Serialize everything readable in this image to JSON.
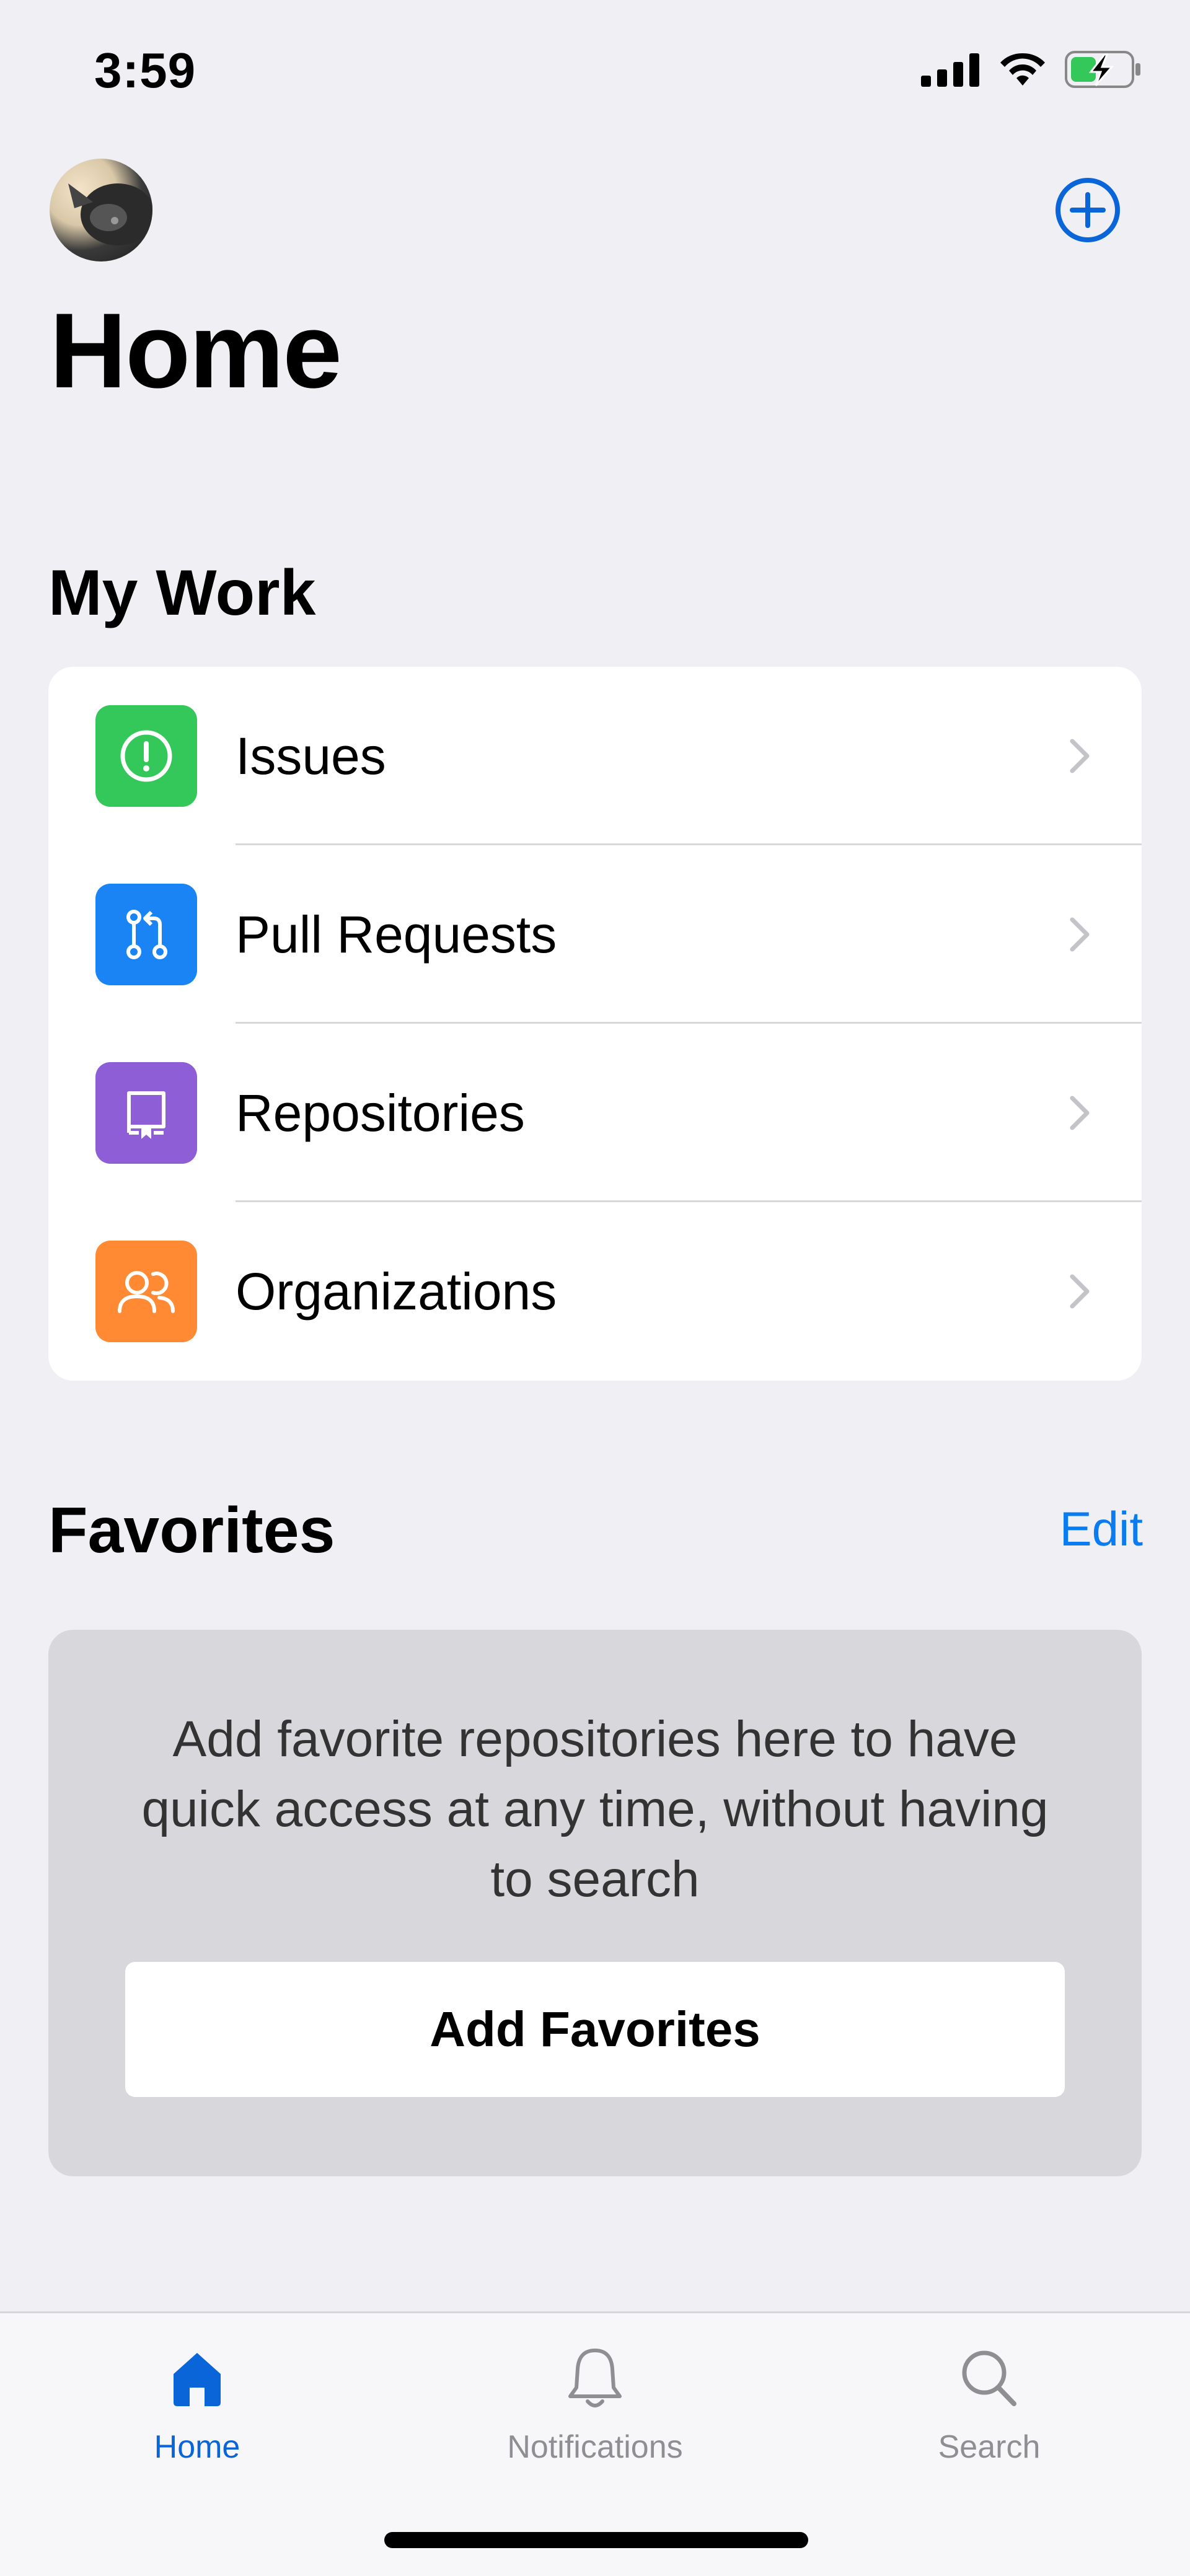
{
  "status_bar": {
    "time": "3:59",
    "icons": [
      "cellular-signal-icon",
      "wifi-icon",
      "battery-charging-icon"
    ]
  },
  "header": {
    "title": "Home",
    "avatar_icon": "user-avatar",
    "add_icon": "plus-circle-icon"
  },
  "my_work": {
    "title": "My Work",
    "items": [
      {
        "label": "Issues",
        "icon": "issue-opened-icon",
        "color": "#34c759"
      },
      {
        "label": "Pull Requests",
        "icon": "git-pull-request-icon",
        "color": "#1a84f5"
      },
      {
        "label": "Repositories",
        "icon": "repo-icon",
        "color": "#8e5ed6"
      },
      {
        "label": "Organizations",
        "icon": "organization-icon",
        "color": "#ff8a33"
      }
    ]
  },
  "favorites": {
    "title": "Favorites",
    "edit_label": "Edit",
    "empty_message": "Add favorite repositories here to have quick access at any time, without having to search",
    "add_button_label": "Add Favorites"
  },
  "tab_bar": {
    "tabs": [
      {
        "label": "Home",
        "icon": "home-icon",
        "active": true
      },
      {
        "label": "Notifications",
        "icon": "bell-icon",
        "active": false
      },
      {
        "label": "Search",
        "icon": "search-icon",
        "active": false
      }
    ]
  },
  "colors": {
    "accent": "#0a66d8",
    "link": "#0a7cf0",
    "background": "#efeff4"
  }
}
